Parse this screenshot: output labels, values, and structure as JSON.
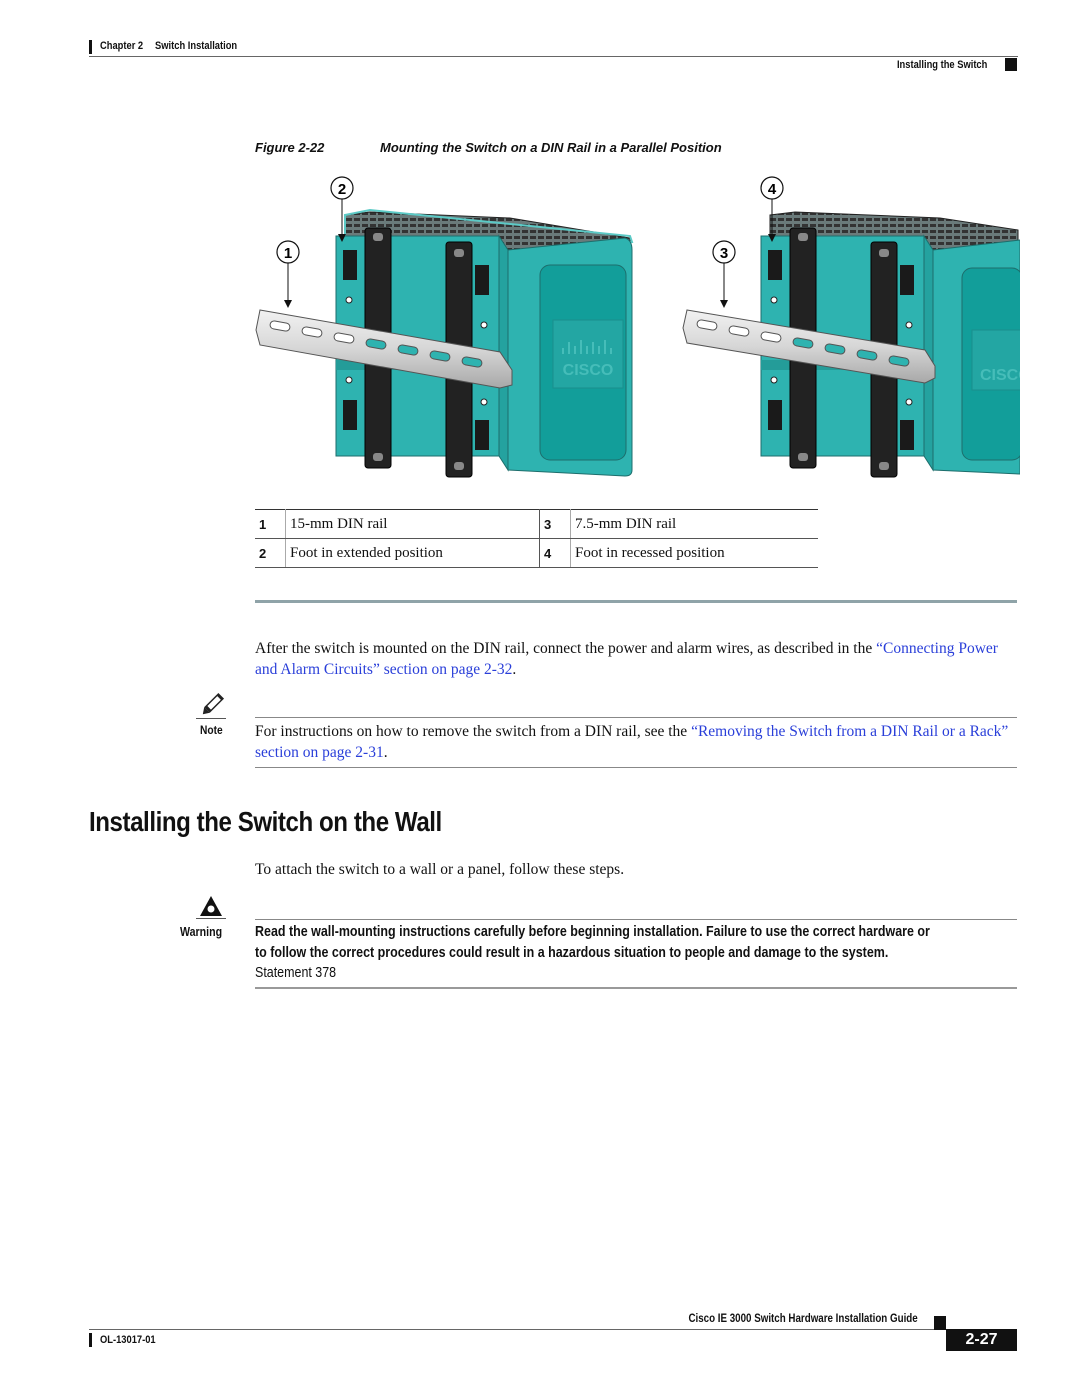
{
  "header": {
    "chapter": "Chapter 2",
    "chapter_title": "Switch Installation",
    "section": "Installing the Switch"
  },
  "figure": {
    "number": "Figure 2-22",
    "title": "Mounting the Switch on a DIN Rail in a Parallel Position",
    "callouts": [
      "1",
      "2",
      "3",
      "4"
    ],
    "logo_text": "CISCO"
  },
  "legend": {
    "rows": [
      {
        "n1": "1",
        "t1": "15-mm DIN rail",
        "n2": "3",
        "t2": "7.5-mm DIN rail"
      },
      {
        "n1": "2",
        "t1": "Foot in extended position",
        "n2": "4",
        "t2": "Foot in recessed position"
      }
    ]
  },
  "body": {
    "para1_text": "After the switch is mounted on the DIN rail, connect the power and alarm wires, as described in the ",
    "para1_link": "“Connecting Power and Alarm Circuits” section on page 2-32",
    "para1_end": "."
  },
  "note": {
    "label": "Note",
    "text": "For instructions on how to remove the switch from a DIN rail, see the ",
    "link": "“Removing the Switch from a DIN Rail or a Rack” section on page 2-31",
    "end": "."
  },
  "section": {
    "heading": "Installing the Switch on the Wall",
    "intro": "To attach the switch to a wall or a panel, follow these steps."
  },
  "warning": {
    "label": "Warning",
    "bold_text": "Read the wall-mounting instructions carefully before beginning installation. Failure to use the correct hardware or to follow the correct procedures could result in a hazardous situation to people and damage to the system.",
    "statement": " Statement 378"
  },
  "footer": {
    "guide_title": "Cisco IE 3000 Switch Hardware Installation Guide",
    "doc_number": "OL-13017-01",
    "page": "2-27"
  },
  "colors": {
    "link": "#2a3fd9",
    "switch_teal": "#2eb3b0",
    "separator": "#8fa3a8"
  }
}
